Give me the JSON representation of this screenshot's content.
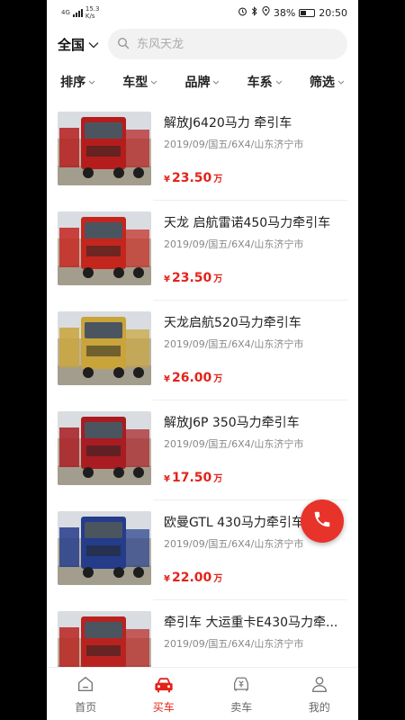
{
  "status_bar": {
    "network_type": "4G",
    "net_speed": "15.3",
    "net_speed_unit": "K/s",
    "battery": "38%",
    "time": "20:50"
  },
  "search": {
    "region": "全国",
    "placeholder": "东风天龙"
  },
  "filters": [
    "排序",
    "车型",
    "品牌",
    "车系",
    "筛选"
  ],
  "listings": [
    {
      "title": "解放J6420马力 牵引车",
      "meta": "2019/09/国五/6X4/山东济宁市",
      "currency": "¥",
      "price": "23.50",
      "unit": "万",
      "cab_color": "#b51d1d"
    },
    {
      "title": "天龙 启航雷诺450马力牵引车",
      "meta": "2019/09/国五/6X4/山东济宁市",
      "currency": "¥",
      "price": "23.50",
      "unit": "万",
      "cab_color": "#c4261e"
    },
    {
      "title": "天龙启航520马力牵引车",
      "meta": "2019/09/国五/6X4/山东济宁市",
      "currency": "¥",
      "price": "26.00",
      "unit": "万",
      "cab_color": "#c9a43a"
    },
    {
      "title": "解放J6P 350马力牵引车",
      "meta": "2019/09/国五/6X4/山东济宁市",
      "currency": "¥",
      "price": "17.50",
      "unit": "万",
      "cab_color": "#a81c22"
    },
    {
      "title": "欧曼GTL 430马力牵引车",
      "meta": "2019/09/国五/6X4/山东济宁市",
      "currency": "¥",
      "price": "22.00",
      "unit": "万",
      "cab_color": "#243c8a"
    },
    {
      "title": "牵引车 大运重卡E430马力牵...",
      "meta": "2019/09/国五/6X4/山东济宁市",
      "currency": "¥",
      "price": "",
      "unit": "",
      "cab_color": "#b82320"
    }
  ],
  "tabs": [
    {
      "label": "首页",
      "icon": "home-icon",
      "active": false
    },
    {
      "label": "买车",
      "icon": "car-icon",
      "active": true
    },
    {
      "label": "卖车",
      "icon": "sell-icon",
      "active": false
    },
    {
      "label": "我的",
      "icon": "user-icon",
      "active": false
    }
  ],
  "colors": {
    "accent": "#e2231a",
    "call_button": "#e8332a"
  }
}
